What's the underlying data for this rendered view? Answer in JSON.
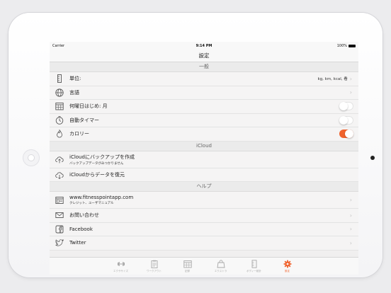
{
  "status": {
    "carrier": "Carrier",
    "time": "9:14 PM",
    "battery": "100%"
  },
  "nav": {
    "title": "設定"
  },
  "sections": {
    "general": "一般",
    "icloud": "iCloud",
    "help": "ヘルプ"
  },
  "general": {
    "units_label": "単位:",
    "units_value": "kg, km, kcal, 看",
    "language_label": "言語",
    "week_start_label": "何曜日はじめ: 月",
    "auto_timer_label": "自動タイマー",
    "calorie_label": "カロリー"
  },
  "toggles": {
    "week_start": false,
    "auto_timer": false,
    "calorie": true
  },
  "icloud": {
    "backup_label": "iCloudにバックアップを作成",
    "backup_sub": "バックアップデータがみつかりません",
    "restore_label": "iCloudからデータを復元"
  },
  "help": {
    "website_label": "www.fitnesspointapp.com",
    "website_sub": "クレジット、ユーザマニュアル",
    "contact_label": "お問い合わせ",
    "facebook_label": "Facebook",
    "twitter_label": "Twitter"
  },
  "tabs": [
    {
      "label": "エクササイズ",
      "icon": "dumbbell-icon"
    },
    {
      "label": "ワークアウト",
      "icon": "clipboard-icon"
    },
    {
      "label": "記録",
      "icon": "calendar-icon"
    },
    {
      "label": "エクストラ",
      "icon": "bag-icon"
    },
    {
      "label": "ボディー統計",
      "icon": "body-stats-icon"
    },
    {
      "label": "設定",
      "icon": "gear-icon"
    }
  ],
  "colors": {
    "accent": "#f0622c"
  }
}
